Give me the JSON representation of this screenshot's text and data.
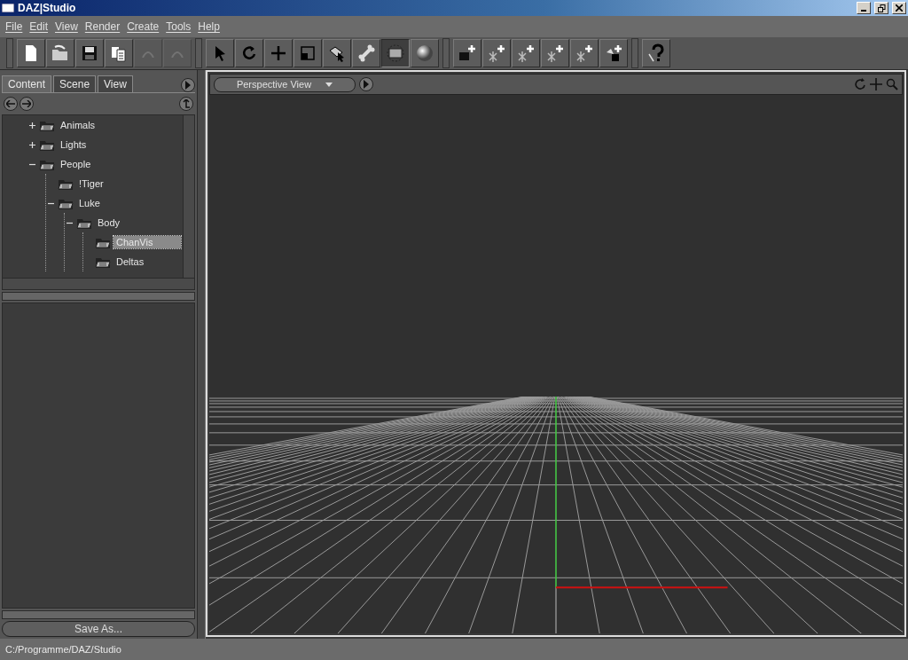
{
  "window": {
    "title": "DAZ|Studio"
  },
  "menu": [
    "File",
    "Edit",
    "View",
    "Render",
    "Create",
    "Tools",
    "Help"
  ],
  "toolbar": [
    {
      "kind": "new",
      "selected": false,
      "disabled": false
    },
    {
      "kind": "open",
      "selected": false,
      "disabled": false
    },
    {
      "kind": "save",
      "selected": false,
      "disabled": false
    },
    {
      "kind": "copy",
      "selected": false,
      "disabled": false
    },
    {
      "kind": "undo",
      "selected": false,
      "disabled": true
    },
    {
      "kind": "redo",
      "selected": false,
      "disabled": true
    },
    {
      "kind": "sep"
    },
    {
      "kind": "select",
      "selected": false,
      "disabled": false
    },
    {
      "kind": "rotate",
      "selected": false,
      "disabled": false
    },
    {
      "kind": "move",
      "selected": false,
      "disabled": false
    },
    {
      "kind": "scale",
      "selected": false,
      "disabled": false
    },
    {
      "kind": "pick",
      "selected": false,
      "disabled": false
    },
    {
      "kind": "bone",
      "selected": false,
      "disabled": false
    },
    {
      "kind": "frame",
      "selected": true,
      "disabled": false
    },
    {
      "kind": "sphere",
      "selected": false,
      "disabled": false
    },
    {
      "kind": "sep"
    },
    {
      "kind": "camera",
      "selected": false,
      "disabled": false
    },
    {
      "kind": "light",
      "selected": false,
      "disabled": false
    },
    {
      "kind": "light",
      "selected": false,
      "disabled": false
    },
    {
      "kind": "light",
      "selected": false,
      "disabled": false
    },
    {
      "kind": "light",
      "selected": false,
      "disabled": false
    },
    {
      "kind": "shape",
      "selected": false,
      "disabled": false
    },
    {
      "kind": "sep"
    },
    {
      "kind": "help",
      "selected": false,
      "disabled": false
    }
  ],
  "tabs": [
    {
      "label": "Content",
      "selected": true
    },
    {
      "label": "Scene",
      "selected": false
    },
    {
      "label": "View",
      "selected": false
    }
  ],
  "tree": [
    {
      "label": "Animals",
      "expanded": false,
      "selected": false
    },
    {
      "label": "Lights",
      "expanded": false,
      "selected": false
    },
    {
      "label": "People",
      "expanded": true,
      "selected": false,
      "children": [
        {
          "label": "!Tiger",
          "selected": false
        },
        {
          "label": "Luke",
          "expanded": true,
          "selected": false,
          "children": [
            {
              "label": "Body",
              "expanded": true,
              "selected": false,
              "children": [
                {
                  "label": "ChanVis",
                  "selected": true
                },
                {
                  "label": "Deltas",
                  "selected": false
                }
              ]
            }
          ]
        }
      ]
    }
  ],
  "save_button": "Save As...",
  "viewport": {
    "view": "Perspective View"
  },
  "status_bar": "C:/Programme/DAZ/Studio"
}
